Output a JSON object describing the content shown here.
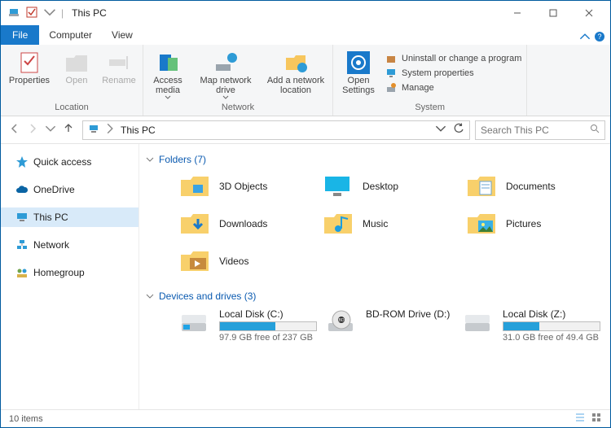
{
  "window": {
    "title": "This PC"
  },
  "tabs": {
    "file": "File",
    "computer": "Computer",
    "view": "View"
  },
  "ribbon": {
    "location": {
      "label": "Location",
      "properties": "Properties",
      "open": "Open",
      "rename": "Rename"
    },
    "network": {
      "label": "Network",
      "access_media": "Access media",
      "map_drive": "Map network drive",
      "add_location": "Add a network location"
    },
    "system": {
      "label": "System",
      "open_settings": "Open Settings",
      "uninstall": "Uninstall or change a program",
      "properties": "System properties",
      "manage": "Manage"
    }
  },
  "nav": {
    "breadcrumb": "This PC",
    "search_placeholder": "Search This PC"
  },
  "sidebar": {
    "quick_access": "Quick access",
    "onedrive": "OneDrive",
    "this_pc": "This PC",
    "network": "Network",
    "homegroup": "Homegroup"
  },
  "sections": {
    "folders": {
      "header": "Folders (7)"
    },
    "drives": {
      "header": "Devices and drives (3)"
    }
  },
  "folders": {
    "objects3d": "3D Objects",
    "desktop": "Desktop",
    "documents": "Documents",
    "downloads": "Downloads",
    "music": "Music",
    "pictures": "Pictures",
    "videos": "Videos"
  },
  "drives": {
    "c": {
      "name": "Local Disk (C:)",
      "info": "97.9 GB free of 237 GB",
      "fill_pct": 58
    },
    "d": {
      "name": "BD-ROM Drive (D:)"
    },
    "z": {
      "name": "Local Disk (Z:)",
      "info": "31.0 GB free of 49.4 GB",
      "fill_pct": 37
    }
  },
  "status": {
    "items": "10 items"
  }
}
